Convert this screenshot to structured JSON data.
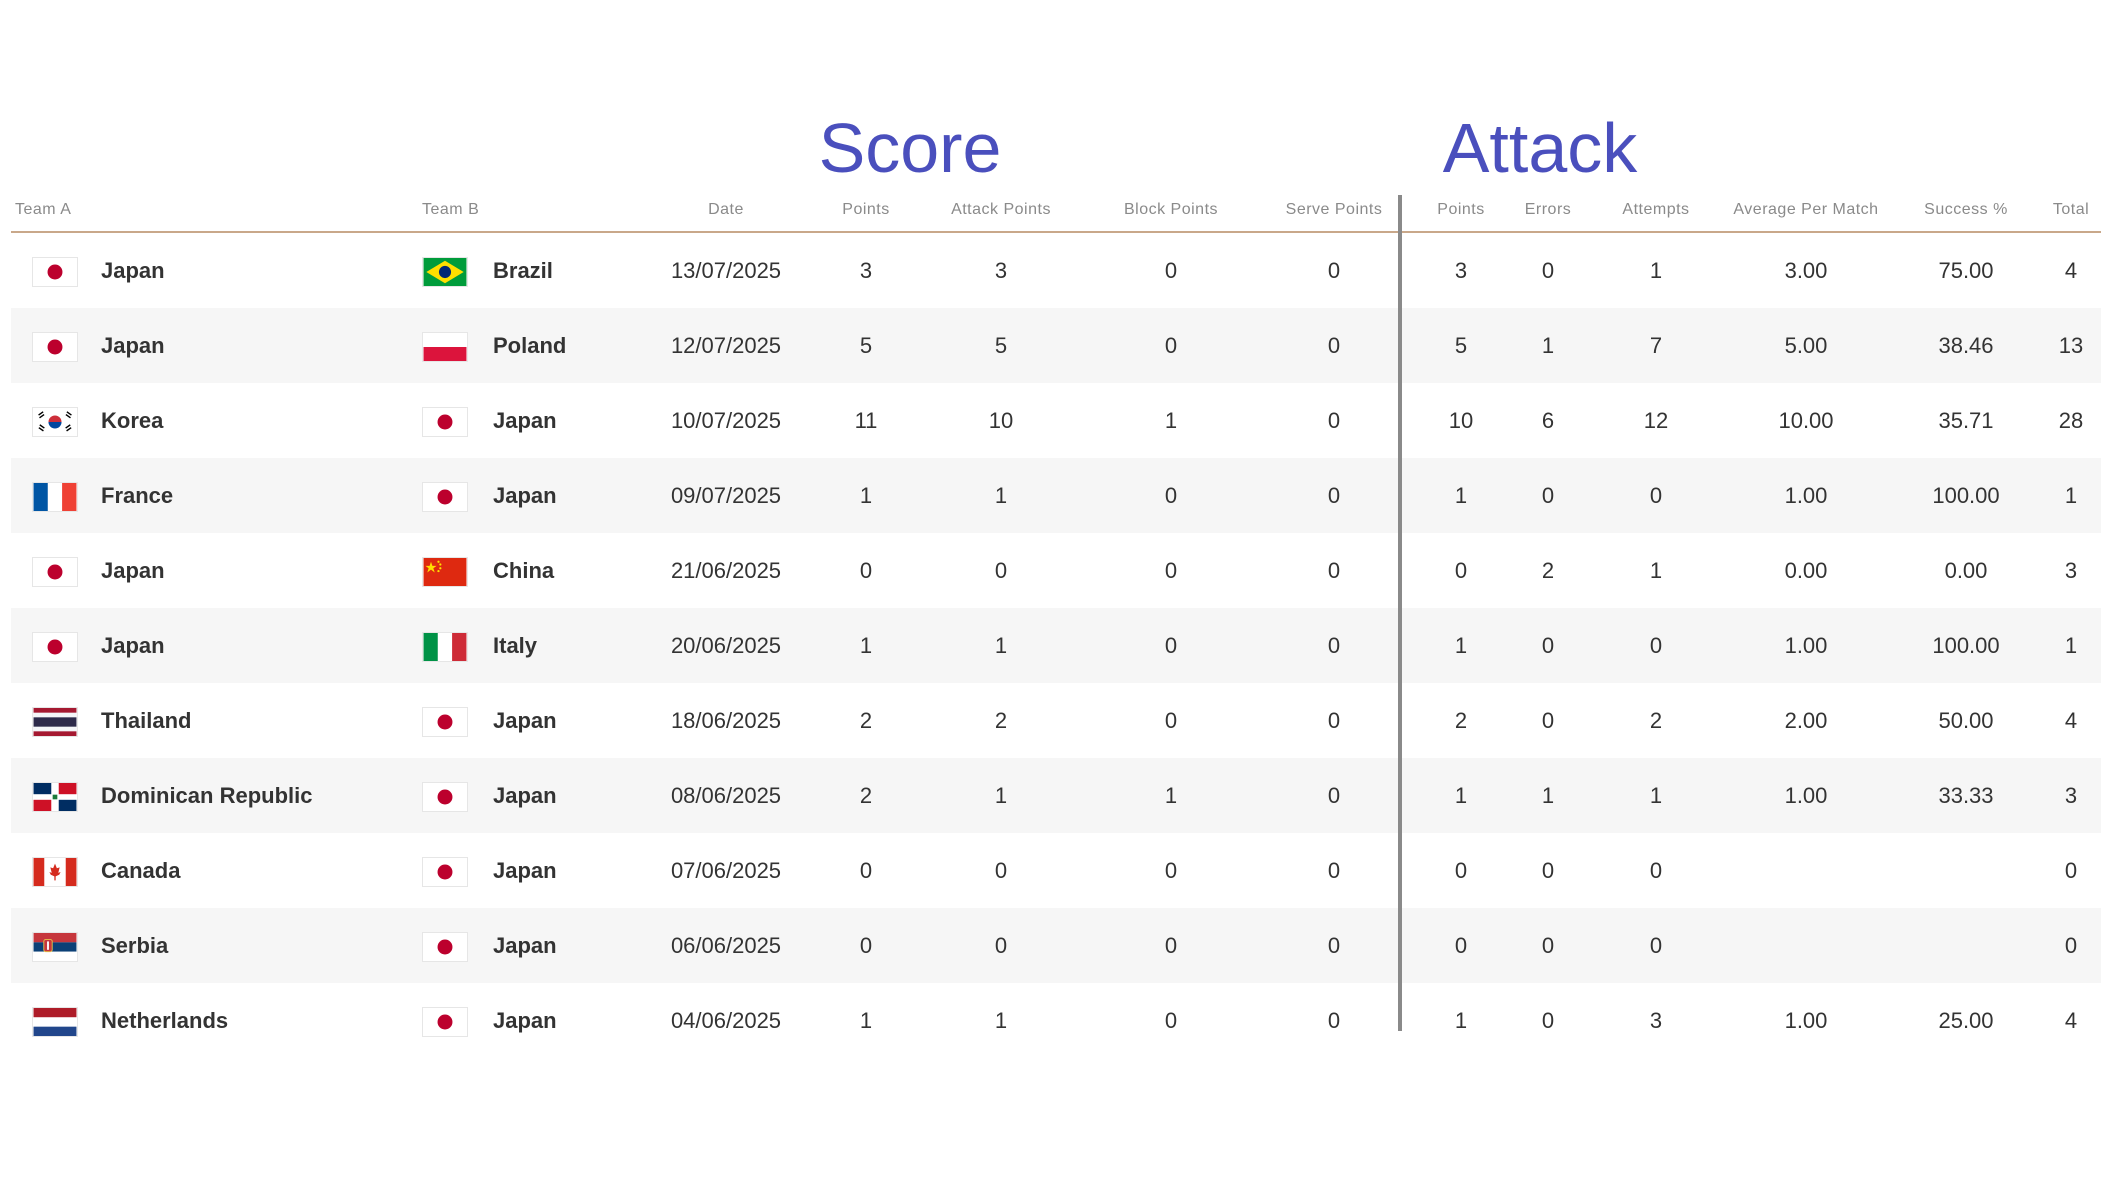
{
  "titles": {
    "score": "Score",
    "attack": "Attack"
  },
  "headers": {
    "team_a": "Team A",
    "team_b": "Team B",
    "date": "Date",
    "score_points": "Points",
    "attack_points": "Attack Points",
    "block_points": "Block Points",
    "serve_points": "Serve Points",
    "attack_points_short": "Points",
    "errors": "Errors",
    "attempts": "Attempts",
    "average_per_match": "Average Per Match",
    "success_pct": "Success %",
    "total": "Total"
  },
  "rows": [
    {
      "team_a": "Japan",
      "team_a_flag": "japan-flag-icon",
      "team_b": "Brazil",
      "team_b_flag": "brazil-flag-icon",
      "date": "13/07/2025",
      "points": "3",
      "attack_points": "3",
      "block_points": "0",
      "serve_points": "0",
      "atk_points": "3",
      "errors": "0",
      "attempts": "1",
      "avg": "3.00",
      "success": "75.00",
      "total": "4"
    },
    {
      "team_a": "Japan",
      "team_a_flag": "japan-flag-icon",
      "team_b": "Poland",
      "team_b_flag": "poland-flag-icon",
      "date": "12/07/2025",
      "points": "5",
      "attack_points": "5",
      "block_points": "0",
      "serve_points": "0",
      "atk_points": "5",
      "errors": "1",
      "attempts": "7",
      "avg": "5.00",
      "success": "38.46",
      "total": "13"
    },
    {
      "team_a": "Korea",
      "team_a_flag": "korea-flag-icon",
      "team_b": "Japan",
      "team_b_flag": "japan-flag-icon",
      "date": "10/07/2025",
      "points": "11",
      "attack_points": "10",
      "block_points": "1",
      "serve_points": "0",
      "atk_points": "10",
      "errors": "6",
      "attempts": "12",
      "avg": "10.00",
      "success": "35.71",
      "total": "28"
    },
    {
      "team_a": "France",
      "team_a_flag": "france-flag-icon",
      "team_b": "Japan",
      "team_b_flag": "japan-flag-icon",
      "date": "09/07/2025",
      "points": "1",
      "attack_points": "1",
      "block_points": "0",
      "serve_points": "0",
      "atk_points": "1",
      "errors": "0",
      "attempts": "0",
      "avg": "1.00",
      "success": "100.00",
      "total": "1"
    },
    {
      "team_a": "Japan",
      "team_a_flag": "japan-flag-icon",
      "team_b": "China",
      "team_b_flag": "china-flag-icon",
      "date": "21/06/2025",
      "points": "0",
      "attack_points": "0",
      "block_points": "0",
      "serve_points": "0",
      "atk_points": "0",
      "errors": "2",
      "attempts": "1",
      "avg": "0.00",
      "success": "0.00",
      "total": "3"
    },
    {
      "team_a": "Japan",
      "team_a_flag": "japan-flag-icon",
      "team_b": "Italy",
      "team_b_flag": "italy-flag-icon",
      "date": "20/06/2025",
      "points": "1",
      "attack_points": "1",
      "block_points": "0",
      "serve_points": "0",
      "atk_points": "1",
      "errors": "0",
      "attempts": "0",
      "avg": "1.00",
      "success": "100.00",
      "total": "1"
    },
    {
      "team_a": "Thailand",
      "team_a_flag": "thailand-flag-icon",
      "team_b": "Japan",
      "team_b_flag": "japan-flag-icon",
      "date": "18/06/2025",
      "points": "2",
      "attack_points": "2",
      "block_points": "0",
      "serve_points": "0",
      "atk_points": "2",
      "errors": "0",
      "attempts": "2",
      "avg": "2.00",
      "success": "50.00",
      "total": "4"
    },
    {
      "team_a": "Dominican Republic",
      "team_a_flag": "dominican-republic-flag-icon",
      "team_b": "Japan",
      "team_b_flag": "japan-flag-icon",
      "date": "08/06/2025",
      "points": "2",
      "attack_points": "1",
      "block_points": "1",
      "serve_points": "0",
      "atk_points": "1",
      "errors": "1",
      "attempts": "1",
      "avg": "1.00",
      "success": "33.33",
      "total": "3"
    },
    {
      "team_a": "Canada",
      "team_a_flag": "canada-flag-icon",
      "team_b": "Japan",
      "team_b_flag": "japan-flag-icon",
      "date": "07/06/2025",
      "points": "0",
      "attack_points": "0",
      "block_points": "0",
      "serve_points": "0",
      "atk_points": "0",
      "errors": "0",
      "attempts": "0",
      "avg": "",
      "success": "",
      "total": "0"
    },
    {
      "team_a": "Serbia",
      "team_a_flag": "serbia-flag-icon",
      "team_b": "Japan",
      "team_b_flag": "japan-flag-icon",
      "date": "06/06/2025",
      "points": "0",
      "attack_points": "0",
      "block_points": "0",
      "serve_points": "0",
      "atk_points": "0",
      "errors": "0",
      "attempts": "0",
      "avg": "",
      "success": "",
      "total": "0"
    },
    {
      "team_a": "Netherlands",
      "team_a_flag": "netherlands-flag-icon",
      "team_b": "Japan",
      "team_b_flag": "japan-flag-icon",
      "date": "04/06/2025",
      "points": "1",
      "attack_points": "1",
      "block_points": "0",
      "serve_points": "0",
      "atk_points": "1",
      "errors": "0",
      "attempts": "3",
      "avg": "1.00",
      "success": "25.00",
      "total": "4"
    }
  ]
}
